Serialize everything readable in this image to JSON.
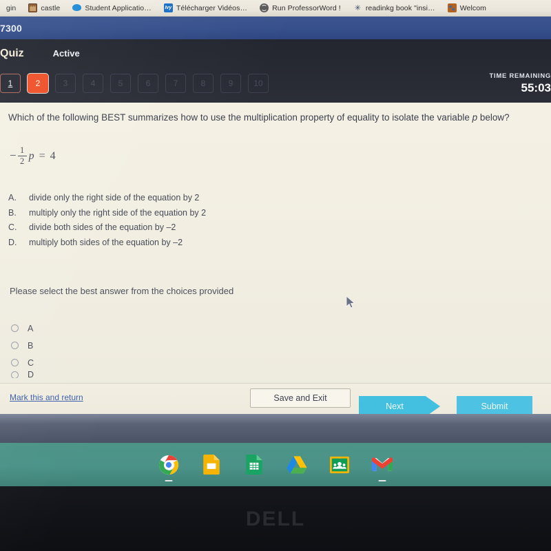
{
  "browser": {
    "bookmarks": [
      {
        "label": "gin",
        "icon": "generic-icon"
      },
      {
        "label": "castle",
        "icon": "castle-icon"
      },
      {
        "label": "Student Applicatio…",
        "icon": "cloud-icon"
      },
      {
        "label": "Télécharger Vidéos…",
        "icon": "ivy-icon"
      },
      {
        "label": "Run ProfessorWord !",
        "icon": "globe-icon"
      },
      {
        "label": "readinkg book \"insi…",
        "icon": "loading-spinner-icon"
      },
      {
        "label": "Welcom",
        "icon": "paw-icon"
      }
    ]
  },
  "window": {
    "title": "7300"
  },
  "quiz": {
    "tab_label": "Quiz",
    "status_label": "Active",
    "question_numbers": [
      "1",
      "2",
      "3",
      "4",
      "5",
      "6",
      "7",
      "8",
      "9",
      "10"
    ],
    "completed_number": "1",
    "current_number": "2",
    "timer_label": "TIME REMAINING",
    "timer_value": "55:03",
    "accent_orange": "#ef5129",
    "header_background": "#272a33",
    "page_background": "#f2efe2"
  },
  "question": {
    "text_part1": "Which of the following BEST summarizes how to use the multiplication property of equality to isolate the variable ",
    "variable": "p",
    "text_part2": " below?",
    "equation": {
      "minus": "−",
      "numerator": "1",
      "denominator": "2",
      "variable": "p",
      "equals": "=",
      "right_side": "4",
      "plain": "−1/2 p = 4"
    },
    "choices": [
      {
        "letter": "A.",
        "text": "divide only the right side of the equation by 2"
      },
      {
        "letter": "B.",
        "text": "multiply only the right side of the equation by 2"
      },
      {
        "letter": "C.",
        "text": "divide both sides of the equation by –2"
      },
      {
        "letter": "D.",
        "text": "multiply both sides of the equation by –2"
      }
    ],
    "prompt": "Please select the best answer from the choices provided",
    "radio_options": [
      "A",
      "B",
      "C",
      "D"
    ]
  },
  "footer": {
    "mark_link": "Mark this and return",
    "save_exit": "Save and Exit",
    "next": "Next",
    "submit": "Submit",
    "next_color": "#43bfe0",
    "submit_color": "#4ec2e2"
  },
  "taskbar": {
    "apps": [
      {
        "name": "chrome-icon",
        "running": true
      },
      {
        "name": "google-slides-icon",
        "running": false
      },
      {
        "name": "google-sheets-icon",
        "running": false
      },
      {
        "name": "google-drive-icon",
        "running": false
      },
      {
        "name": "google-classroom-icon",
        "running": false
      },
      {
        "name": "gmail-icon",
        "running": true
      }
    ],
    "shelf_color": "#4b9288"
  },
  "device": {
    "brand": "DELL"
  }
}
